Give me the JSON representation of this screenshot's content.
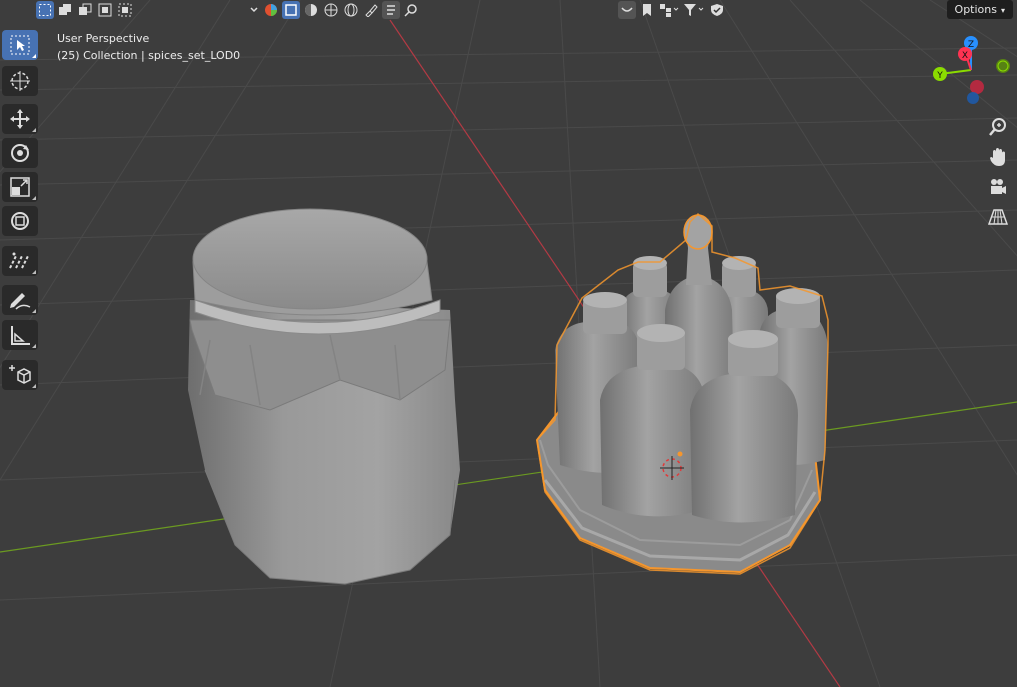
{
  "viewport": {
    "view_name": "User Perspective",
    "collection_info": "(25) Collection | spices_set_LOD0"
  },
  "header": {
    "options_label": "Options",
    "select_modes": [
      "select-box-new-icon",
      "select-extend-icon",
      "select-subtract-icon",
      "select-invert-icon",
      "select-intersect-icon"
    ],
    "shading_modes": [
      "shading-icon",
      "object-mode-icon",
      "sphere-icon",
      "grid-sphere-icon",
      "globe-icon",
      "paint-icon",
      "text-icon",
      "search-icon"
    ],
    "right_controls": [
      "view-pin-icon",
      "bookmark-icon",
      "hierarchy-icon",
      "filter-icon",
      "shield-icon"
    ]
  },
  "toolbar": {
    "tools": [
      {
        "name": "select-tool",
        "icon": "cursor-arrow-icon",
        "active": true
      },
      {
        "name": "cursor-tool",
        "icon": "cursor-target-icon",
        "active": false
      },
      {
        "name": "move-tool",
        "icon": "move-arrows-icon",
        "active": false
      },
      {
        "name": "rotate-tool",
        "icon": "rotate-icon",
        "active": false
      },
      {
        "name": "scale-tool",
        "icon": "scale-icon",
        "active": false
      },
      {
        "name": "transform-tool",
        "icon": "transform-icon",
        "active": false
      },
      {
        "name": "annotate-tool",
        "icon": "annotate-icon",
        "active": false
      },
      {
        "name": "draw-tool",
        "icon": "pencil-icon",
        "active": false
      },
      {
        "name": "measure-tool",
        "icon": "ruler-icon",
        "active": false
      },
      {
        "name": "add-cube-tool",
        "icon": "add-cube-icon",
        "active": false
      }
    ]
  },
  "gizmo": {
    "axis_z": "Z",
    "axis_y": "Y",
    "axis_x": "X",
    "colors": {
      "x": "#ff3352",
      "y": "#8bdc00",
      "z": "#2890ff"
    }
  },
  "nav_buttons": [
    "zoom-icon",
    "hand-pan-icon",
    "camera-icon",
    "perspective-grid-icon"
  ],
  "colors": {
    "background": "#3d3d3d",
    "accent": "#4772b3",
    "selection": "#f5962d",
    "x_axis": "#bf3b45",
    "y_axis": "#6b9a21"
  }
}
